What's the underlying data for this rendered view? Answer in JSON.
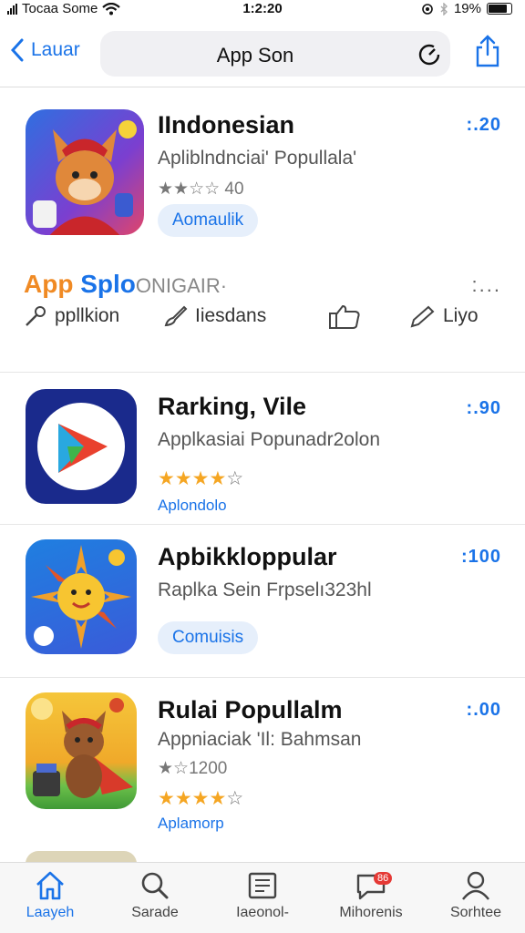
{
  "status": {
    "carrier": "Tocaa Some",
    "time": "1:2:20",
    "battery": "19%"
  },
  "nav": {
    "back_label": "Lauar",
    "title": "App Son"
  },
  "apps": [
    {
      "name": "IIndonesian",
      "subtitle": "Apliblndnciai' Popullala'",
      "rating_text": "40",
      "price": ":.20",
      "pill": "Aomaulik"
    },
    {
      "name": "Rarking, Vile",
      "subtitle": "Applkasiai Popunadr2olon",
      "tag": "Aplondolo",
      "price": ":.90",
      "stars_filled": 4
    },
    {
      "name": "Apbikkloppular",
      "subtitle": "Raplka Sein Frpselı323hl",
      "pill": "Comuisis",
      "price": ":100"
    },
    {
      "name": "Rulai Popullalm",
      "subtitle": "Appniaciak 'Il: Bahmsan",
      "rating_text": "1200",
      "tag": "Aplamorp",
      "price": ":.00",
      "stars_filled": 4
    }
  ],
  "section": {
    "title_a": "App",
    "title_b": "Splo",
    "title_c": "ONIGAIR·",
    "more": ":..."
  },
  "categories": [
    {
      "label": "ppllkion",
      "icon": "wrench-icon"
    },
    {
      "label": "Iiesdans",
      "icon": "paint-brush-icon"
    },
    {
      "label": "",
      "icon": "thumbs-up-icon"
    },
    {
      "label": "Liyo",
      "icon": "pen-icon"
    }
  ],
  "tabs": [
    {
      "label": "Laayeh",
      "icon": "home-icon",
      "active": true
    },
    {
      "label": "Sarade",
      "icon": "search-icon"
    },
    {
      "label": "Iaeonol-",
      "icon": "document-icon"
    },
    {
      "label": "Mihorenis",
      "icon": "notifications-icon",
      "badge": "86"
    },
    {
      "label": "Sorhtee",
      "icon": "profile-icon"
    }
  ],
  "colors": {
    "accent": "#1a73e8",
    "star": "#f5a623",
    "orange": "#f08a24"
  }
}
